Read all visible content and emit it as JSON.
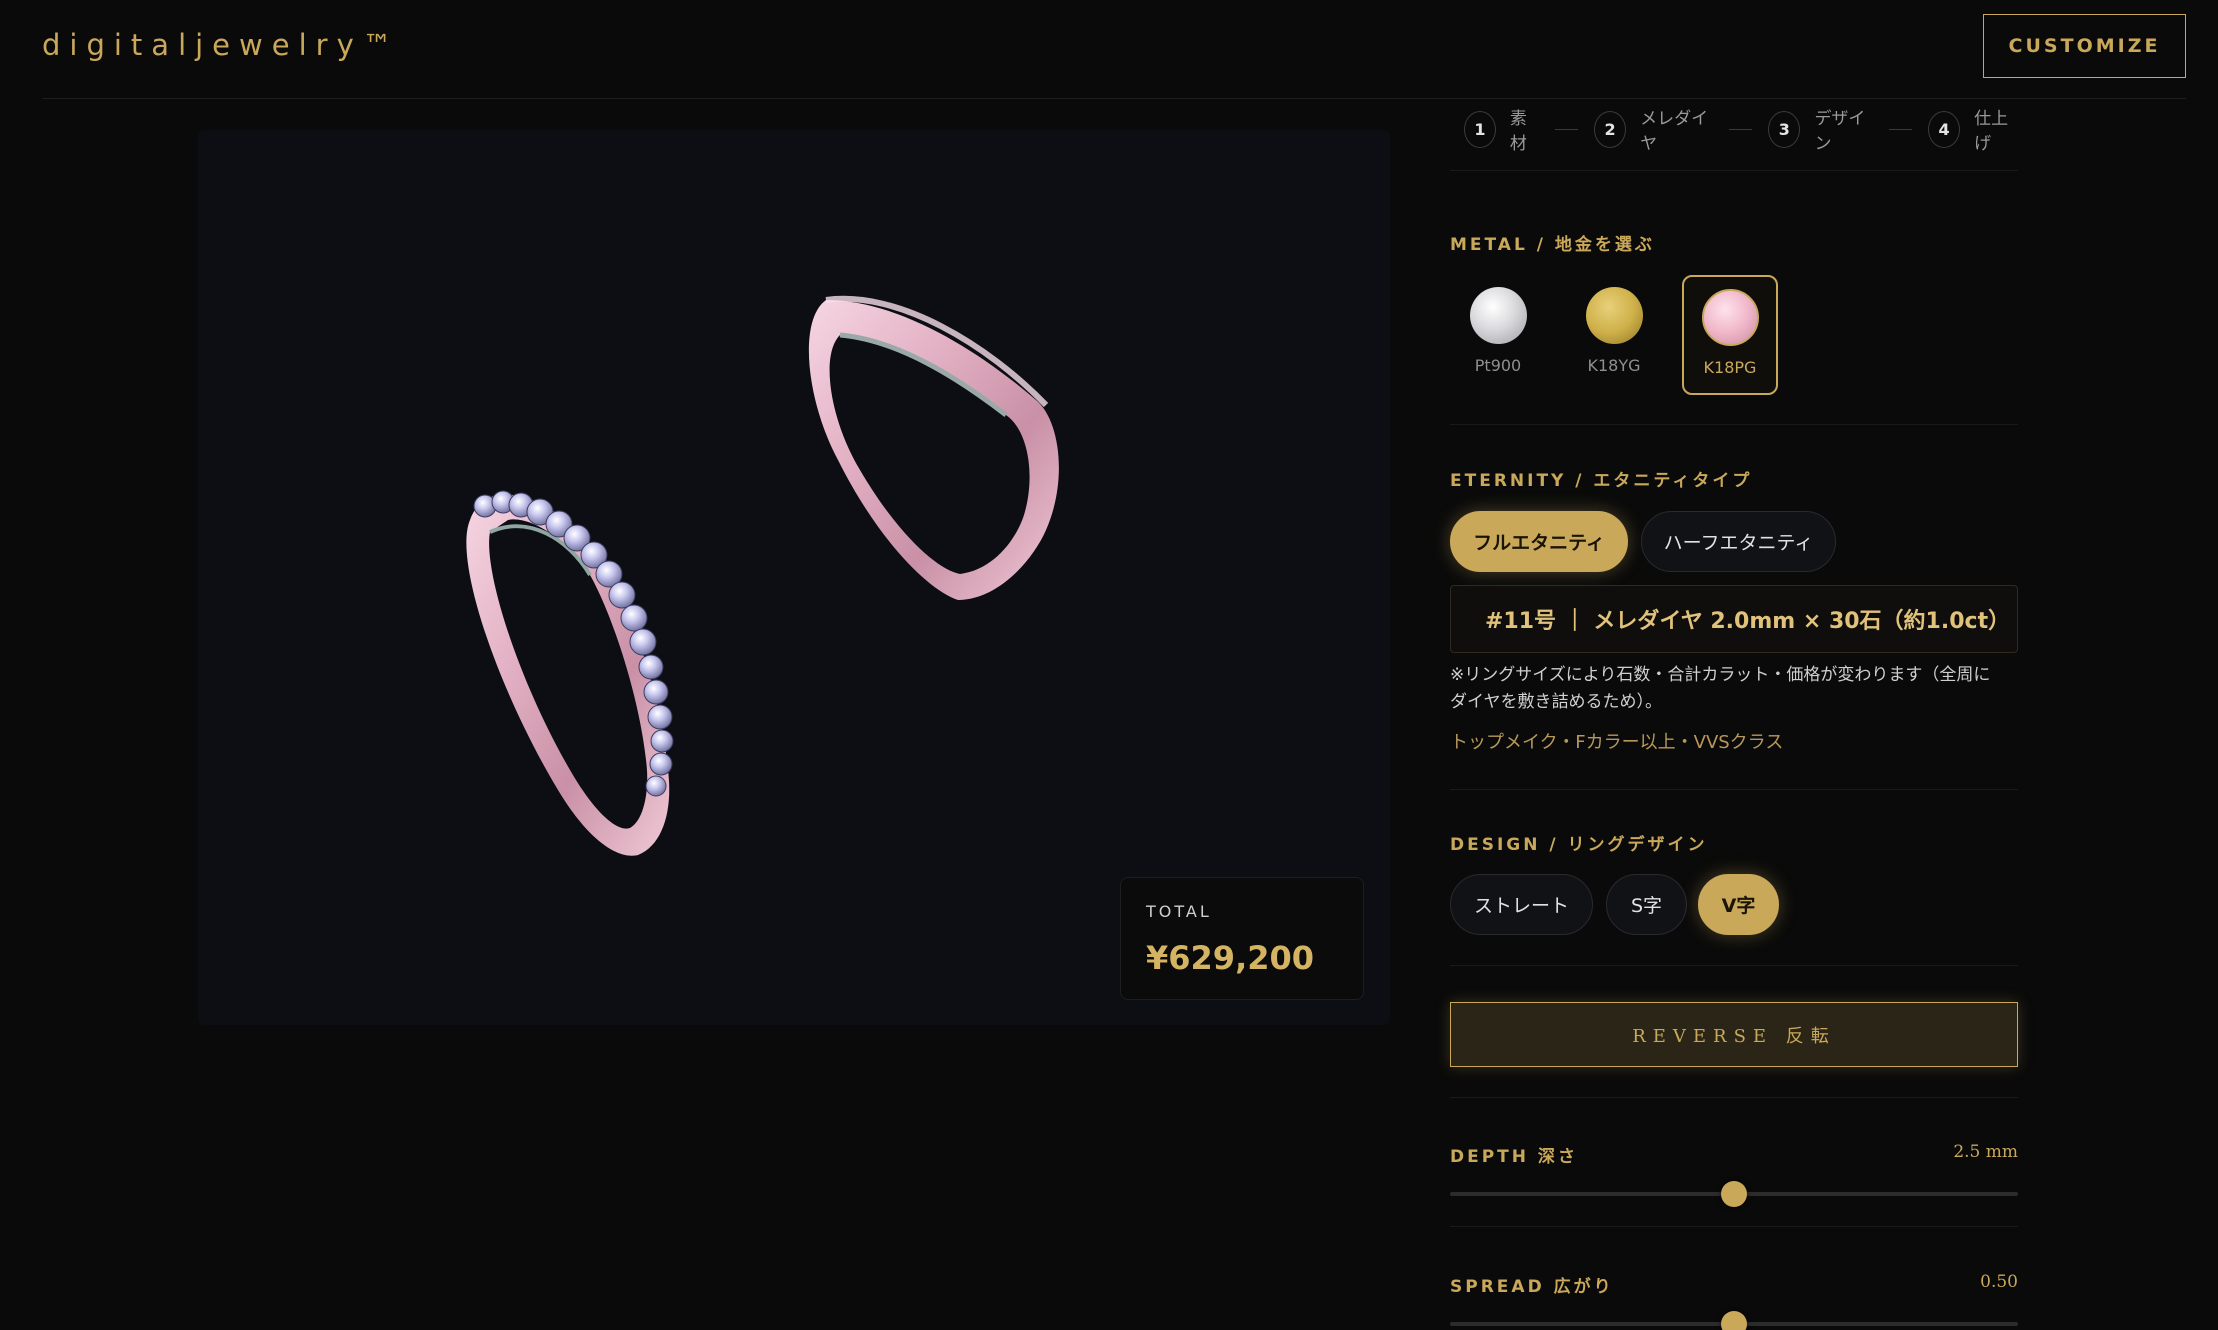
{
  "header": {
    "logo": "digitaljewelry™",
    "customize_label": "CUSTOMIZE"
  },
  "viewer": {
    "total_label": "TOTAL",
    "total_price": "¥629,200"
  },
  "steps": [
    {
      "num": "1",
      "label": "素材"
    },
    {
      "num": "2",
      "label": "メレダイヤ"
    },
    {
      "num": "3",
      "label": "デザイン"
    },
    {
      "num": "4",
      "label": "仕上げ"
    }
  ],
  "metal": {
    "title": "METAL / 地金を選ぶ",
    "options": [
      {
        "label": "Pt900",
        "color": "#d9d9dc"
      },
      {
        "label": "K18YG",
        "color": "#cfb14a"
      },
      {
        "label": "K18PG",
        "color": "#f0b7c9"
      }
    ],
    "selected": "K18PG"
  },
  "eternity": {
    "title": "ETERNITY / エタニティタイプ",
    "options": [
      "フルエタニティ",
      "ハーフエタニティ"
    ],
    "selected": "フルエタニティ",
    "info": "#11号 ｜ メレダイヤ 2.0mm × 30石（約1.0ct）",
    "note_line1": "※リングサイズにより石数・合計カラット・価格が変わります（全周に",
    "note_line2": "ダイヤを敷き詰めるため）。",
    "quality": "トップメイク・Fカラー以上・VVSクラス"
  },
  "design": {
    "title": "DESIGN / リングデザイン",
    "options": [
      "ストレート",
      "S字",
      "V字"
    ],
    "selected": "V字"
  },
  "reverse_label": "REVERSE 反転",
  "depth": {
    "label": "DEPTH 深さ",
    "value": "2.5 mm",
    "position": 0.5
  },
  "spread": {
    "label": "SPREAD 広がり",
    "value": "0.50",
    "position": 0.5
  },
  "colors": {
    "accent": "#c9a85a",
    "background": "#0a0a0a",
    "ring_metal": "#e8b6c8"
  }
}
